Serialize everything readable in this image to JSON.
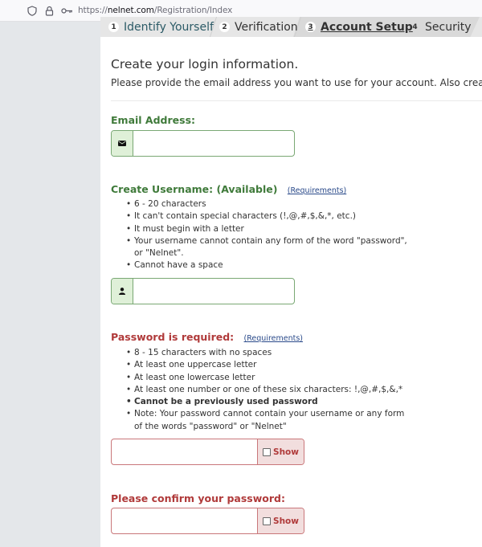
{
  "browser": {
    "url_prefix": "https://",
    "url_domain": "nelnet.com",
    "url_path": "/Registration/Index"
  },
  "steps": [
    {
      "num": "1",
      "label": "Identify Yourself",
      "state": "done"
    },
    {
      "num": "2",
      "label": "Verification",
      "state": "done"
    },
    {
      "num": "3",
      "label": "Account Setup",
      "state": "current"
    },
    {
      "num": "4",
      "label": "Security",
      "state": "upcoming"
    }
  ],
  "form": {
    "title": "Create your login information.",
    "description": "Please provide the email address you want to use for your account. Also create a usern",
    "email": {
      "label": "Email Address:",
      "value": "",
      "icon": "envelope-icon"
    },
    "username": {
      "label": "Create Username: (Available)",
      "requirements_link": "(Requirements)",
      "rules": [
        "6 - 20 characters",
        "It can't contain special characters (!,@,#,$,&,*, etc.)",
        "It must begin with a letter",
        "Your username cannot contain any form of the word \"password\", or \"Nelnet\".",
        "Cannot have a space"
      ],
      "value": "",
      "icon": "user-icon"
    },
    "password": {
      "label": "Password is required:",
      "requirements_link": "(Requirements)",
      "rules": [
        "8 - 15 characters with no spaces",
        "At least one uppercase letter",
        "At least one lowercase letter",
        "At least one number or one of these six characters: !,@,#,$,&,*",
        "Cannot be a previously used password",
        "Note: Your password cannot contain your username or any form of the words \"password\" or \"Nelnet\""
      ],
      "value": "",
      "show_label": "Show",
      "show_checked": false
    },
    "confirm": {
      "label": "Please confirm your password:",
      "value": "",
      "show_label": "Show",
      "show_checked": false
    }
  },
  "colors": {
    "valid": "#3f7a3a",
    "error": "#b03a3a",
    "link": "#2a4a8a"
  }
}
